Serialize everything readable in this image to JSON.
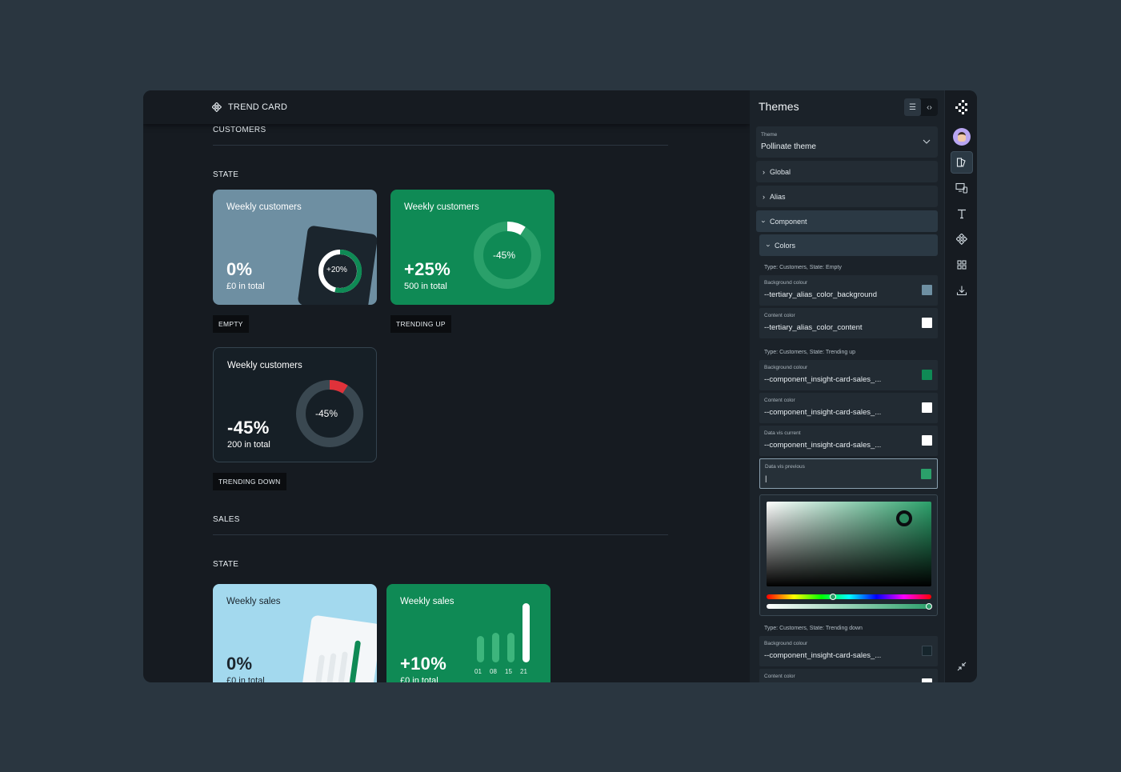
{
  "canvas": {
    "logo_label": "TREND CARD",
    "customers_label": "CUSTOMERS",
    "state_label_1": "STATE",
    "sales_label": "SALES",
    "state_label_2": "STATE",
    "cards": [
      {
        "title": "Weekly customers",
        "value": "0%",
        "sub": "£0 in total",
        "ring_label": "+20%",
        "tag": "EMPTY",
        "ring_progress": 0.2
      },
      {
        "title": "Weekly customers",
        "value": "+25%",
        "sub": "500 in total",
        "ring_label": "-45%",
        "tag": "TRENDING UP",
        "ring_progress": 0.1
      },
      {
        "title": "Weekly customers",
        "value": "-45%",
        "sub": "200 in total",
        "ring_label": "-45%",
        "tag": "TRENDING DOWN",
        "ring_progress": 0.1
      }
    ],
    "sales_cards": [
      {
        "title": "Weekly sales",
        "value": "0%",
        "sub": "£0 in total"
      },
      {
        "title": "Weekly sales",
        "value": "+10%",
        "sub": "£0 in total",
        "bar_labels": [
          "01",
          "08",
          "15",
          "21"
        ],
        "bars": [
          0.45,
          0.5,
          0.5,
          1.0
        ]
      }
    ]
  },
  "panel": {
    "title": "Themes",
    "theme_label": "Theme",
    "theme_value": "Pollinate theme",
    "accordions": [
      "Global",
      "Alias",
      "Component",
      "Colors"
    ],
    "groups": [
      {
        "label": "Type: Customers, State: Empty",
        "fields": [
          {
            "label": "Background colour",
            "value": "--tertiary_alias_color_background",
            "color": "#6e8fa2"
          },
          {
            "label": "Content color",
            "value": "--tertiary_alias_color_content",
            "color": "#ffffff"
          }
        ]
      },
      {
        "label": "Type: Customers, State: Trending up",
        "fields": [
          {
            "label": "Background colour",
            "value": "--component_insight-card-sales_...",
            "color": "#0f8a55"
          },
          {
            "label": "Content color",
            "value": "--component_insight-card-sales_...",
            "color": "#ffffff"
          },
          {
            "label": "Data vis current",
            "value": "--component_insight-card-sales_...",
            "color": "#ffffff"
          },
          {
            "label": "Data vis previous",
            "value": "|",
            "color": "#2ba06a"
          }
        ]
      },
      {
        "label": "Type: Customers, State: Trending down",
        "fields": [
          {
            "label": "Background colour",
            "value": "--component_insight-card-sales_...",
            "color": "#16252c"
          },
          {
            "label": "Content color",
            "value": "",
            "color": "#ffffff"
          }
        ]
      }
    ]
  },
  "colors": {
    "empty_card": "#6e8fa2",
    "trending_up_card": "#0f8a55",
    "trending_down_card": "#161f26",
    "sales_empty_card": "#a3d9ee",
    "accent_red": "#e0323a"
  }
}
